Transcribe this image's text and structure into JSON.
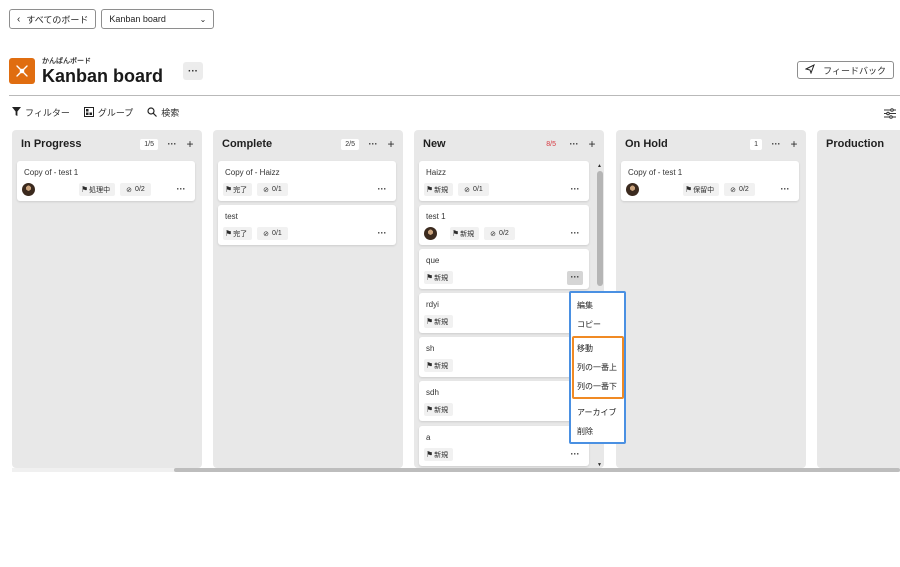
{
  "nav": {
    "back_label": "すべてのボード",
    "board_select_value": "Kanban board"
  },
  "header": {
    "subtitle": "かんばんボード",
    "title": "Kanban board",
    "more": "···",
    "feedback_label": "フィードバック"
  },
  "toolbar": {
    "filter_label": "フィルター",
    "group_label": "グループ",
    "search_label": "検索"
  },
  "columns": [
    {
      "title": "In Progress",
      "count": "1/5",
      "cards": [
        {
          "title": "Copy of - test 1",
          "status": "処理中",
          "tasks": "0/2",
          "avatar": true
        }
      ]
    },
    {
      "title": "Complete",
      "count": "2/5",
      "cards": [
        {
          "title": "Copy of - Haizz",
          "status": "完了",
          "tasks": "0/1"
        },
        {
          "title": "test",
          "status": "完了",
          "tasks": "0/1"
        }
      ]
    },
    {
      "title": "New",
      "count": "8/5",
      "count_over_limit": true,
      "cards": [
        {
          "title": "Haizz",
          "status": "新規",
          "tasks": "0/1"
        },
        {
          "title": "test 1",
          "status": "新規",
          "tasks": "0/2",
          "avatar": true
        },
        {
          "title": "que",
          "status": "新規"
        },
        {
          "title": "rdyi",
          "status": "新規"
        },
        {
          "title": "sh",
          "status": "新規"
        },
        {
          "title": "sdh",
          "status": "新規"
        },
        {
          "title": "a",
          "status": "新規"
        }
      ]
    },
    {
      "title": "On Hold",
      "count": "1",
      "cards": [
        {
          "title": "Copy of - test 1",
          "status": "保留中",
          "tasks": "0/2",
          "avatar": true
        }
      ]
    },
    {
      "title": "Production"
    }
  ],
  "context_menu": {
    "items": [
      "編集",
      "コピー",
      "移動",
      "列の一番上",
      "列の一番下",
      "アーカイブ",
      "削除"
    ]
  },
  "colors": {
    "accent_orange": "#e06d10",
    "menu_border_blue": "#4a90e2",
    "highlight_orange": "#f08a24",
    "over_limit_red": "#d7373f"
  }
}
